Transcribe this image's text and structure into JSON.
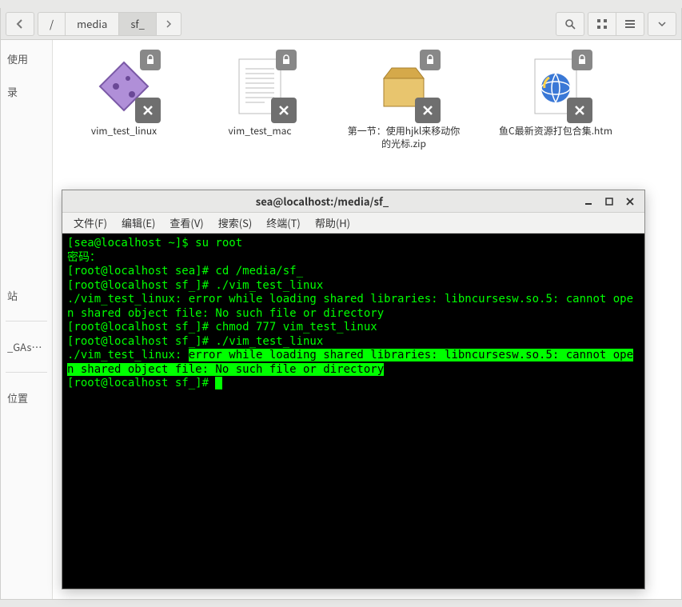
{
  "file_manager": {
    "breadcrumb": [
      "/",
      "media",
      "sf_"
    ],
    "sidebar": {
      "items": [
        "使用",
        "录",
        "站",
        "_GAs_…",
        "位置"
      ]
    },
    "files": [
      {
        "label": "vim_test_linux",
        "icon": "exec"
      },
      {
        "label": "vim_test_mac",
        "icon": "doc"
      },
      {
        "label": "第一节：使用hjkl来移动你的光标.zip",
        "icon": "zip"
      },
      {
        "label": "鱼C最新资源打包合集.htm",
        "icon": "htm"
      }
    ]
  },
  "terminal": {
    "title": "sea@localhost:/media/sf_",
    "menus": [
      "文件(F)",
      "编辑(E)",
      "查看(V)",
      "搜索(S)",
      "终端(T)",
      "帮助(H)"
    ],
    "lines": [
      {
        "t": "[sea@localhost ~]$ su root"
      },
      {
        "t": "密码："
      },
      {
        "t": "[root@localhost sea]# cd /media/sf_"
      },
      {
        "t": "[root@localhost sf_]# ./vim_test_linux"
      },
      {
        "t": "./vim_test_linux: error while loading shared libraries: libncursesw.so.5: cannot open shared object file: No such file or directory"
      },
      {
        "t": "[root@localhost sf_]# chmod 777 vim_test_linux"
      },
      {
        "t": "[root@localhost sf_]# ./vim_test_linux"
      }
    ],
    "highlighted_prefix": "./vim_test_linux: ",
    "highlighted_1": "error while loading shared libraries: libncursesw.so.5: cannot ",
    "highlighted_2": "open shared object file: No such file or directory",
    "prompt_final": "[root@localhost sf_]# "
  }
}
